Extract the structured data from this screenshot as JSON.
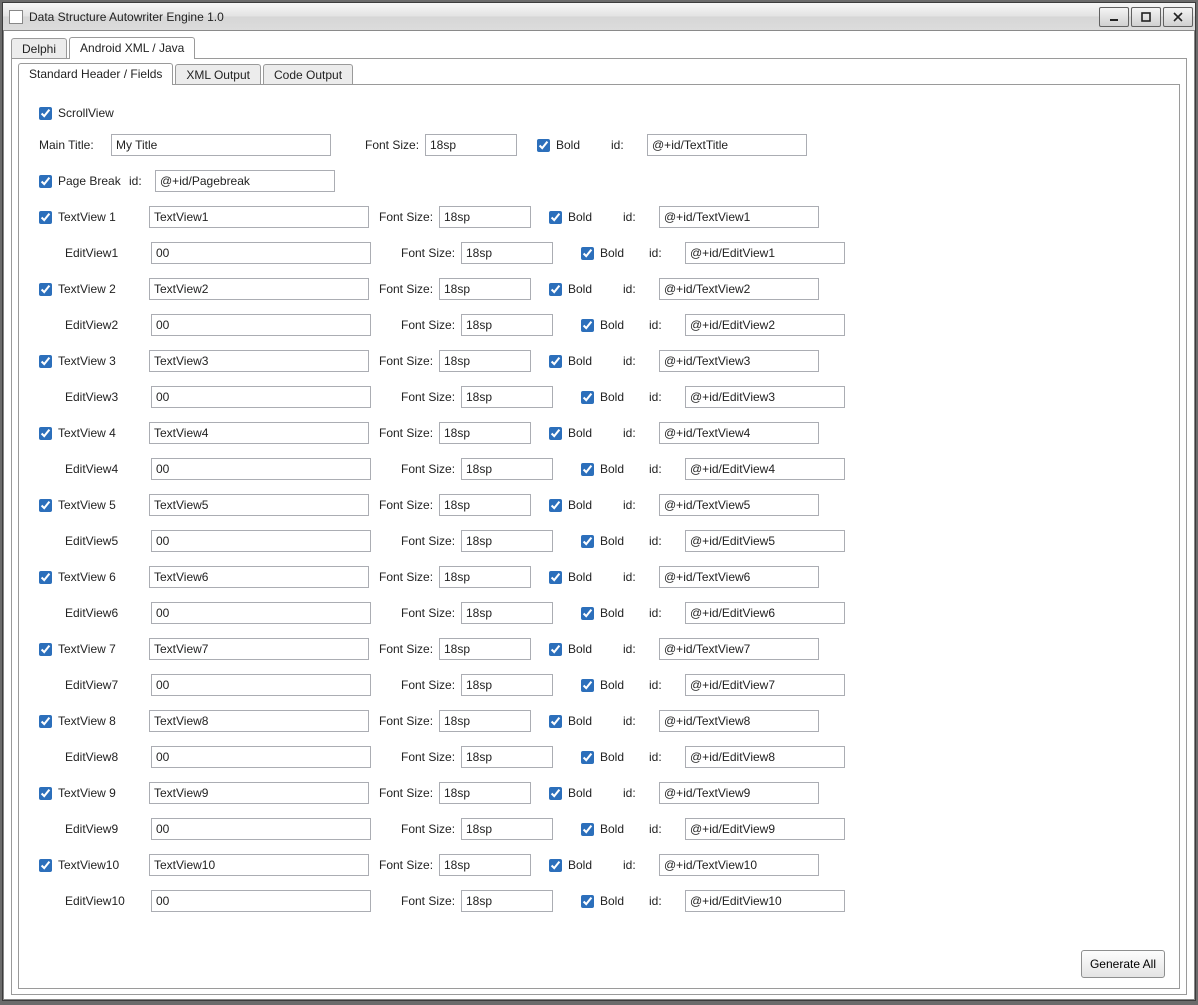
{
  "window_title": "Data Structure Autowriter Engine 1.0",
  "tabs_top": {
    "delphi": "Delphi",
    "android": "Android XML / Java"
  },
  "tabs_inner": {
    "std": "Standard Header / Fields",
    "xml": "XML Output",
    "code": "Code Output"
  },
  "scrollview_label": "ScrollView",
  "main_title_label": "Main Title:",
  "main_title_value": "My Title",
  "font_size_label": "Font Size:",
  "bold_label": "Bold",
  "id_label": "id:",
  "title_font_size": "18sp",
  "title_id": "@+id/TextTitle",
  "page_break_label": "Page Break",
  "page_break_id": "@+id/Pagebreak",
  "generate_all_label": "Generate All",
  "rows": [
    {
      "tv_cb_label": "TextView 1",
      "tv_val": "TextView1",
      "tv_fs": "18sp",
      "tv_id": "@+id/TextView1",
      "ev_label": "EditView1",
      "ev_val": "00",
      "ev_fs": "18sp",
      "ev_id": "@+id/EditView1"
    },
    {
      "tv_cb_label": "TextView 2",
      "tv_val": "TextView2",
      "tv_fs": "18sp",
      "tv_id": "@+id/TextView2",
      "ev_label": "EditView2",
      "ev_val": "00",
      "ev_fs": "18sp",
      "ev_id": "@+id/EditView2"
    },
    {
      "tv_cb_label": "TextView 3",
      "tv_val": "TextView3",
      "tv_fs": "18sp",
      "tv_id": "@+id/TextView3",
      "ev_label": "EditView3",
      "ev_val": "00",
      "ev_fs": "18sp",
      "ev_id": "@+id/EditView3"
    },
    {
      "tv_cb_label": "TextView 4",
      "tv_val": "TextView4",
      "tv_fs": "18sp",
      "tv_id": "@+id/TextView4",
      "ev_label": "EditView4",
      "ev_val": "00",
      "ev_fs": "18sp",
      "ev_id": "@+id/EditView4"
    },
    {
      "tv_cb_label": "TextView 5",
      "tv_val": "TextView5",
      "tv_fs": "18sp",
      "tv_id": "@+id/TextView5",
      "ev_label": "EditView5",
      "ev_val": "00",
      "ev_fs": "18sp",
      "ev_id": "@+id/EditView5"
    },
    {
      "tv_cb_label": "TextView 6",
      "tv_val": "TextView6",
      "tv_fs": "18sp",
      "tv_id": "@+id/TextView6",
      "ev_label": "EditView6",
      "ev_val": "00",
      "ev_fs": "18sp",
      "ev_id": "@+id/EditView6"
    },
    {
      "tv_cb_label": "TextView 7",
      "tv_val": "TextView7",
      "tv_fs": "18sp",
      "tv_id": "@+id/TextView7",
      "ev_label": "EditView7",
      "ev_val": "00",
      "ev_fs": "18sp",
      "ev_id": "@+id/EditView7"
    },
    {
      "tv_cb_label": "TextView 8",
      "tv_val": "TextView8",
      "tv_fs": "18sp",
      "tv_id": "@+id/TextView8",
      "ev_label": "EditView8",
      "ev_val": "00",
      "ev_fs": "18sp",
      "ev_id": "@+id/EditView8"
    },
    {
      "tv_cb_label": "TextView 9",
      "tv_val": "TextView9",
      "tv_fs": "18sp",
      "tv_id": "@+id/TextView9",
      "ev_label": "EditView9",
      "ev_val": "00",
      "ev_fs": "18sp",
      "ev_id": "@+id/EditView9"
    },
    {
      "tv_cb_label": "TextView10",
      "tv_val": "TextView10",
      "tv_fs": "18sp",
      "tv_id": "@+id/TextView10",
      "ev_label": "EditView10",
      "ev_val": "00",
      "ev_fs": "18sp",
      "ev_id": "@+id/EditView10"
    }
  ]
}
